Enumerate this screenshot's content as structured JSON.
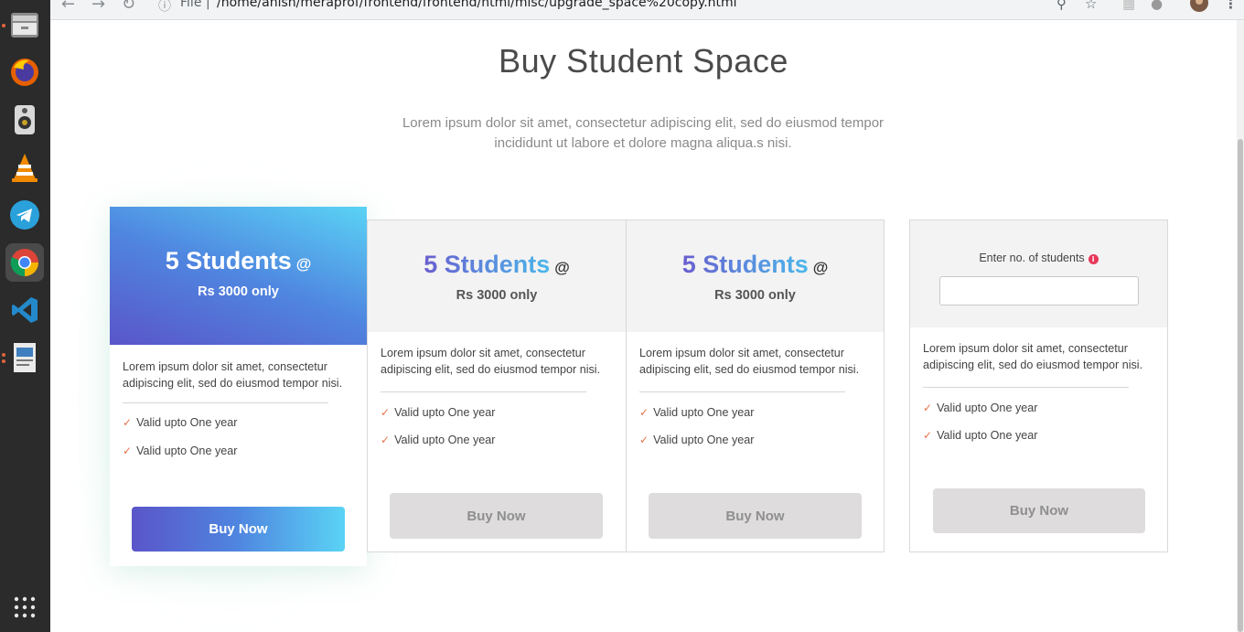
{
  "browser": {
    "url_scheme": "File",
    "url": "/home/anish/meraprof/frontend/frontend/html/misc/upgrade_space%20copy.html"
  },
  "dock": {
    "apps": [
      "files-icon",
      "firefox-icon",
      "speaker-icon",
      "vlc-icon",
      "telegram-icon",
      "chrome-icon",
      "vscode-icon",
      "document-viewer-icon"
    ],
    "show_apps": "grid-icon"
  },
  "page": {
    "title": "Buy Student Space",
    "subtitle": "Lorem ipsum dolor sit amet, consectetur adipiscing elit, sed do eiusmod tempor incididunt ut labore et dolore magna aliqua.s nisi."
  },
  "plans": [
    {
      "students": "5 Students",
      "at": "@",
      "price": "Rs 3000 only",
      "description": "Lorem ipsum dolor sit amet, consectetur adipiscing elit, sed do eiusmod tempor nisi.",
      "features": [
        "Valid upto One year",
        "Valid upto One year"
      ],
      "button": "Buy Now"
    },
    {
      "students": "5 Students",
      "at": "@",
      "price": "Rs 3000 only",
      "description": "Lorem ipsum dolor sit amet, consectetur adipiscing elit, sed do eiusmod tempor nisi.",
      "features": [
        "Valid upto One year",
        "Valid upto One year"
      ],
      "button": "Buy Now"
    },
    {
      "students": "5 Students",
      "at": "@",
      "price": "Rs 3000 only",
      "description": "Lorem ipsum dolor sit amet, consectetur adipiscing elit, sed do eiusmod tempor nisi.",
      "features": [
        "Valid upto One year",
        "Valid upto One year"
      ],
      "button": "Buy Now"
    }
  ],
  "custom_plan": {
    "label": "Enter no. of students",
    "info_icon": "info-icon",
    "input_value": "",
    "description": "Lorem ipsum dolor sit amet, consectetur adipiscing elit, sed do eiusmod tempor nisi.",
    "features": [
      "Valid upto One year",
      "Valid upto One year"
    ],
    "button": "Buy Now"
  },
  "colors": {
    "accent_start": "#5a55c9",
    "accent_end": "#5ad3f5",
    "check": "#e8734a",
    "info": "#e8385a"
  }
}
